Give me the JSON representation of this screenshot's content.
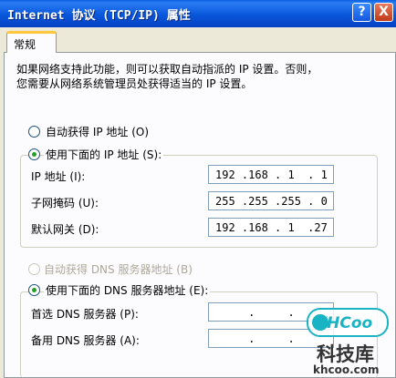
{
  "window": {
    "title": "Internet 协议 (TCP/IP) 属性",
    "help_button": "?",
    "close_button": "X"
  },
  "tabs": [
    {
      "label": "常规",
      "selected": true
    }
  ],
  "description": {
    "line1": "如果网络支持此功能，则可以获取自动指派的 IP 设置。否则，",
    "line2": "您需要从网络系统管理员处获得适当的 IP 设置。"
  },
  "ip_section": {
    "auto_option": {
      "label": "自动获得 IP 地址 (O)",
      "selected": false
    },
    "manual_option": {
      "label": "使用下面的 IP 地址 (S):",
      "selected": true
    },
    "fields": [
      {
        "label": "IP 地址 (I):",
        "value": "192 .168 . 1  . 1"
      },
      {
        "label": "子网掩码 (U):",
        "value": "255 .255 .255 . 0"
      },
      {
        "label": "默认网关 (D):",
        "value": "192 .168 . 1  .27"
      }
    ]
  },
  "dns_section": {
    "auto_option": {
      "label": "自动获得 DNS 服务器地址 (B)",
      "selected": false,
      "disabled": true
    },
    "manual_option": {
      "label": "使用下面的 DNS 服务器地址 (E):",
      "selected": true
    },
    "fields": [
      {
        "label": "首选 DNS 服务器 (P):",
        "value": "     .     ."
      },
      {
        "label": "备用 DNS 服务器 (A):",
        "value": "     .     ."
      }
    ]
  },
  "watermark": {
    "logo_text": "KHCoo",
    "name": "科技库",
    "url": "khcoo.com"
  },
  "colors": {
    "titlebar": "#0856da",
    "dialog_bg": "#ece9d8",
    "tab_highlight": "#ffc83c",
    "radio_dot": "#21a121",
    "logo_teal": "#19b3c4"
  }
}
